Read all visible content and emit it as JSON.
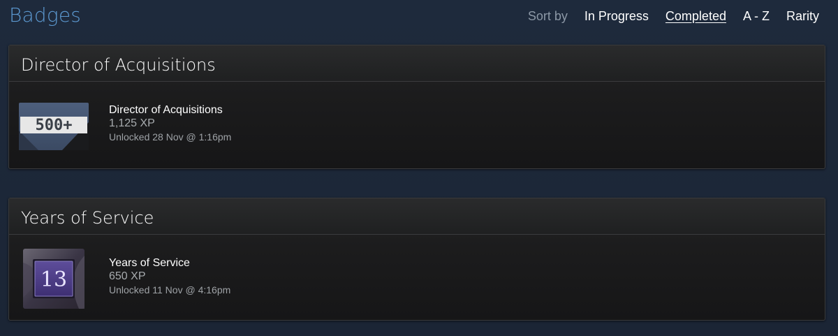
{
  "header": {
    "title": "Badges",
    "sort_label": "Sort by",
    "sort_options": [
      "In Progress",
      "Completed",
      "A - Z",
      "Rarity"
    ],
    "active_sort": "Completed"
  },
  "badges": [
    {
      "section_title": "Director of Acquisitions",
      "name": "Director of Acquisitions",
      "xp": "1,125 XP",
      "unlocked": "Unlocked 28 Nov @ 1:16pm",
      "icon": "500-plus-badge-icon",
      "icon_text": "500+"
    },
    {
      "section_title": "Years of Service",
      "name": "Years of Service",
      "xp": "650 XP",
      "unlocked": "Unlocked 11 Nov @ 4:16pm",
      "icon": "years-of-service-badge-icon",
      "icon_text": "13"
    }
  ],
  "colors": {
    "title_blue": "#5c99d1",
    "card_bg": "#1c1c1d",
    "page_bg": "#1b2536"
  }
}
